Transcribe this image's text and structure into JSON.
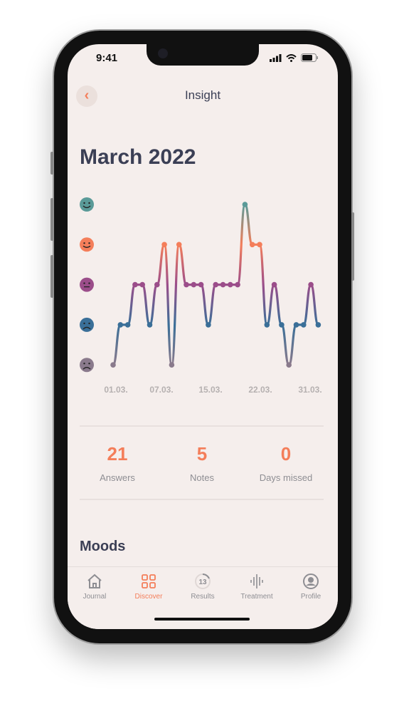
{
  "status_bar": {
    "time": "9:41"
  },
  "header": {
    "title": "Insight",
    "back_icon": "chevron-left-icon"
  },
  "month_title": "March 2022",
  "chart_data": {
    "type": "line",
    "y_levels": [
      "awful",
      "bad",
      "meh",
      "good",
      "great"
    ],
    "ylim": [
      1,
      5
    ],
    "values": [
      1,
      2,
      2,
      3,
      3,
      2,
      3,
      4,
      1,
      4,
      3,
      3,
      3,
      2,
      3,
      3,
      3,
      3,
      5,
      4,
      4,
      2,
      3,
      2,
      1,
      2,
      2,
      3,
      2
    ],
    "x_tick_labels": [
      "01.03.",
      "07.03.",
      "15.03.",
      "22.03.",
      "31.03."
    ],
    "colors": {
      "5": "#5a9a98",
      "4": "#f47e5a",
      "3": "#9b4d8a",
      "2": "#3a6f98",
      "1": "#8a7a8c"
    }
  },
  "stats": [
    {
      "value": "21",
      "label": "Answers"
    },
    {
      "value": "5",
      "label": "Notes"
    },
    {
      "value": "0",
      "label": "Days missed"
    }
  ],
  "moods_heading": "Moods",
  "tabs": [
    {
      "label": "Journal",
      "icon": "home-icon"
    },
    {
      "label": "Discover",
      "icon": "grid-icon",
      "active": true
    },
    {
      "label": "Results",
      "icon": "progress-ring-icon",
      "badge": "13"
    },
    {
      "label": "Treatment",
      "icon": "waveform-icon"
    },
    {
      "label": "Profile",
      "icon": "user-circle-icon"
    }
  ],
  "accent": "#f47e5a"
}
